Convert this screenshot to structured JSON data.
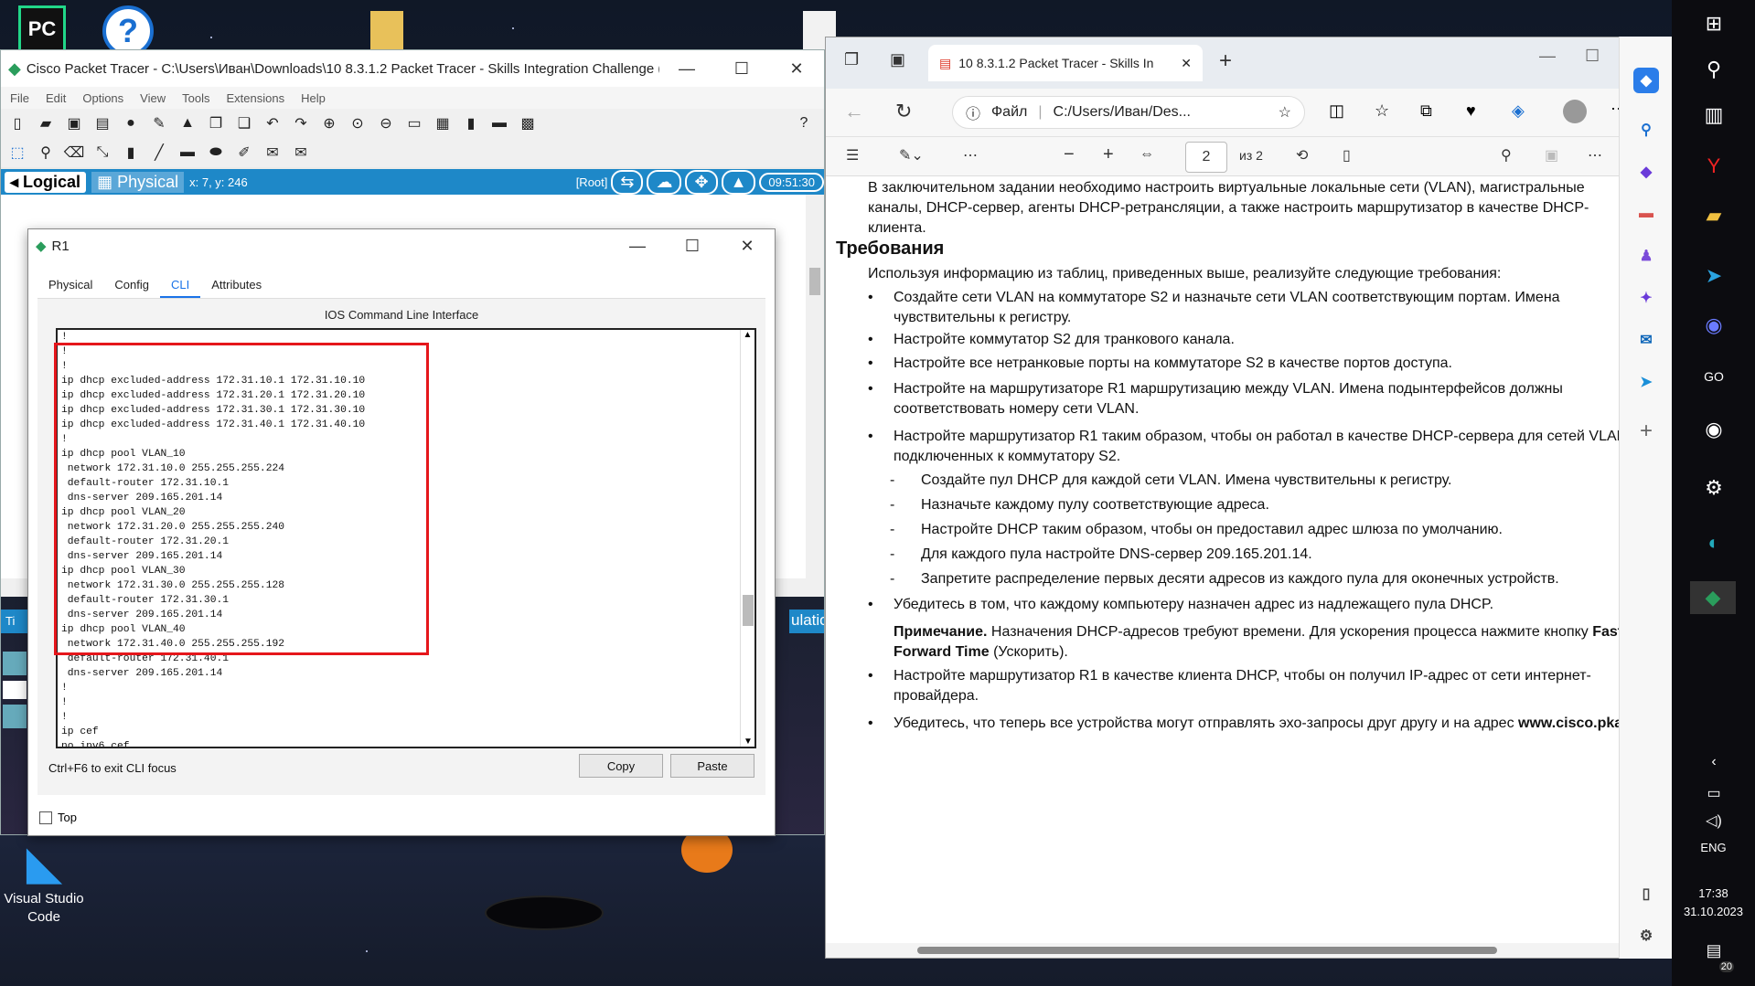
{
  "desktop": {
    "icons": [
      {
        "name": "pycharm",
        "label": "PC"
      },
      {
        "name": "help",
        "label": "?"
      }
    ],
    "vscode_label": "Visual Studio Code"
  },
  "packet_tracer": {
    "title": "Cisco Packet Tracer - C:\\Users\\Иван\\Downloads\\10 8.3.1.2 Packet Tracer - Skills Integration Challenge (...",
    "menu": [
      "File",
      "Edit",
      "Options",
      "View",
      "Tools",
      "Extensions",
      "Help"
    ],
    "logical_tab": "Logical",
    "physical_tab": "Physical",
    "coords": "x: 7, y: 246",
    "root_label": "[Root]",
    "clock": "09:51:30",
    "simulation_partial": "ulation",
    "realtime_partial": "Ti"
  },
  "r1_window": {
    "title": "R1",
    "tabs": [
      "Physical",
      "Config",
      "CLI",
      "Attributes"
    ],
    "active_tab": "CLI",
    "cli_title": "IOS Command Line Interface",
    "cli_lines": [
      "!",
      "!",
      "!",
      "ip dhcp excluded-address 172.31.10.1 172.31.10.10",
      "ip dhcp excluded-address 172.31.20.1 172.31.20.10",
      "ip dhcp excluded-address 172.31.30.1 172.31.30.10",
      "ip dhcp excluded-address 172.31.40.1 172.31.40.10",
      "!",
      "ip dhcp pool VLAN_10",
      " network 172.31.10.0 255.255.255.224",
      " default-router 172.31.10.1",
      " dns-server 209.165.201.14",
      "ip dhcp pool VLAN_20",
      " network 172.31.20.0 255.255.255.240",
      " default-router 172.31.20.1",
      " dns-server 209.165.201.14",
      "ip dhcp pool VLAN_30",
      " network 172.31.30.0 255.255.255.128",
      " default-router 172.31.30.1",
      " dns-server 209.165.201.14",
      "ip dhcp pool VLAN_40",
      " network 172.31.40.0 255.255.255.192",
      " default-router 172.31.40.1",
      " dns-server 209.165.201.14",
      "!",
      "!",
      "!",
      "ip cef",
      "no ipv6 cef"
    ],
    "hint": "Ctrl+F6 to exit CLI focus",
    "copy_label": "Copy",
    "paste_label": "Paste",
    "top_label": "Top"
  },
  "edge": {
    "tab_title": "10 8.3.1.2 Packet Tracer - Skills In",
    "url_prefix": "Файл",
    "url": "C:/Users/Иван/Des...",
    "page_current": "2",
    "page_total": "из 2",
    "intro": "В заключительном задании необходимо настроить виртуальные локальные сети (VLAN), магистральные каналы, DHCP-сервер, агенты DHCP-ретрансляции, а также настроить маршрутизатор в качестве DHCP-клиента.",
    "heading": "Требования",
    "lead": "Используя информацию из таблиц, приведенных выше, реализуйте следующие требования:",
    "bullets": [
      "Создайте сети VLAN на коммутаторе S2 и назначьте сети VLAN соответствующим портам. Имена чувствительны к регистру.",
      "Настройте коммутатор S2 для транкового канала.",
      "Настройте все нетранковые порты на коммутаторе S2 в качестве портов доступа.",
      "Настройте на маршрутизаторе R1 маршрутизацию между VLAN. Имена подынтерфейсов должны соответствовать номеру сети VLAN.",
      "Настройте маршрутизатор R1 таким образом, чтобы он работал в качестве DHCP-сервера для сетей VLAN, подключенных к коммутатору S2."
    ],
    "sub_bullets": [
      "Создайте пул DHCP для каждой сети VLAN. Имена чувствительны к регистру.",
      "Назначьте каждому пулу соответствующие адреса.",
      "Настройте DHCP таким образом, чтобы он предоставил адрес шлюза по умолчанию.",
      "Для каждого пула настройте DNS-сервер 209.165.201.14.",
      "Запретите распределение первых десяти адресов из каждого пула для оконечных устройств."
    ],
    "bullet6": "Убедитесь в том, что каждому компьютеру назначен адрес из надлежащего пула DHCP.",
    "note_label": "Примечание.",
    "note_text": " Назначения DHCP-адресов требуют времени. Для ускорения процесса нажмите кнопку ",
    "note_bold": "Fast Forward Time",
    "note_end": " (Ускорить).",
    "bullet7": "Настройте маршрутизатор R1 в качестве клиента DHCP, чтобы он получил IP-адрес от сети интернет-провайдера.",
    "bullet8": "Убедитесь, что теперь все устройства могут отправлять эхо-запросы друг другу и на адрес",
    "bullet8_bold": "www.cisco.pka",
    "bullet8_end": "."
  },
  "taskbar": {
    "lang": "ENG",
    "time": "17:38",
    "date": "31.10.2023",
    "notif_count": "20"
  }
}
